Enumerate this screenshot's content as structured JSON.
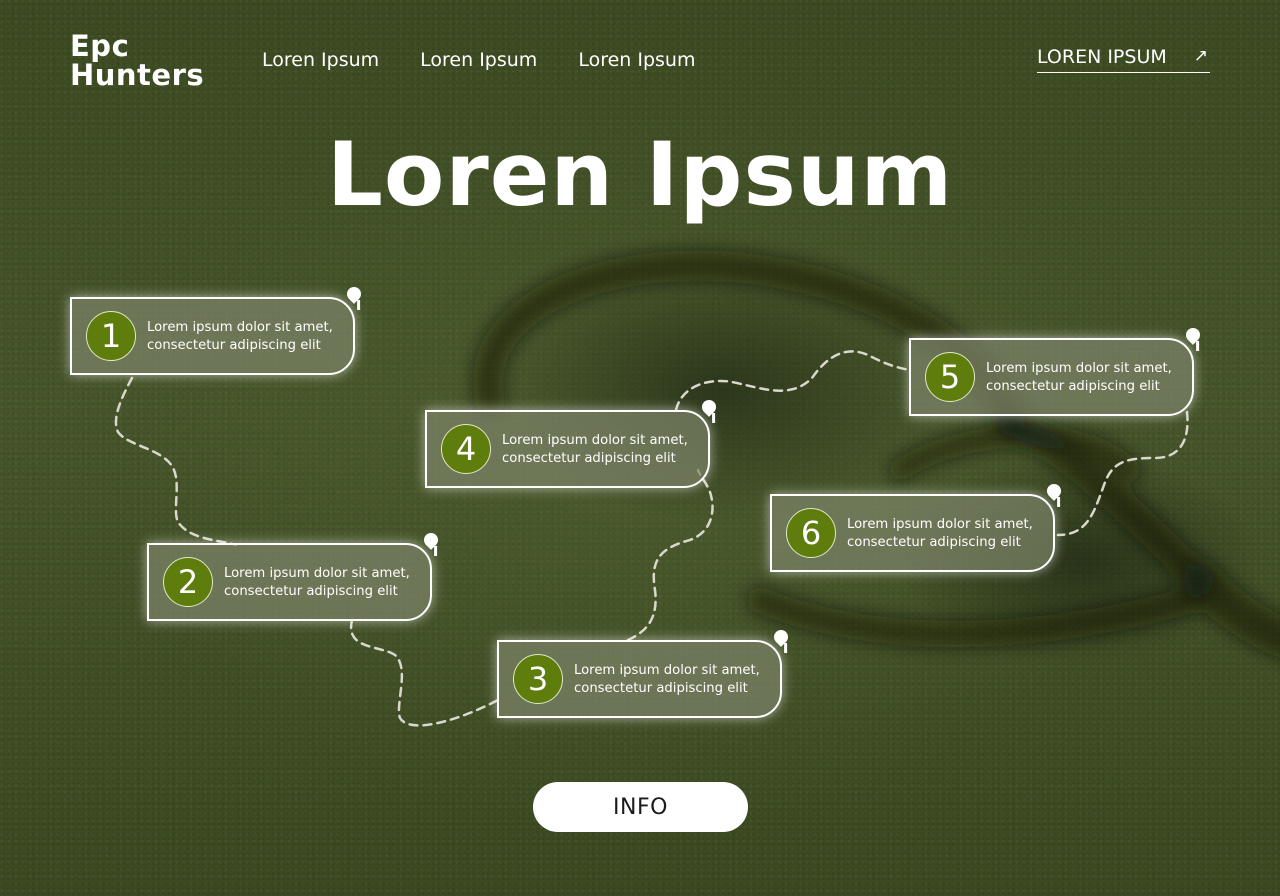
{
  "brand": {
    "line1": "Epc",
    "line2": "Hunters"
  },
  "nav": {
    "items": [
      "Loren Ipsum",
      "Loren Ipsum",
      "Loren Ipsum"
    ]
  },
  "header_cta": {
    "label": "LOREN IPSUM",
    "icon": "arrow-up-right-icon"
  },
  "hero": {
    "title": "Loren Ipsum"
  },
  "steps": [
    {
      "number": "1",
      "line1": "Lorem ipsum dolor sit amet,",
      "line2": "consectetur adipiscing elit"
    },
    {
      "number": "2",
      "line1": "Lorem ipsum dolor sit amet,",
      "line2": "consectetur adipiscing elit"
    },
    {
      "number": "3",
      "line1": "Lorem ipsum dolor sit amet,",
      "line2": "consectetur adipiscing elit"
    },
    {
      "number": "4",
      "line1": "Lorem ipsum dolor sit amet,",
      "line2": "consectetur adipiscing elit"
    },
    {
      "number": "5",
      "line1": "Lorem ipsum dolor sit amet,",
      "line2": "consectetur adipiscing elit"
    },
    {
      "number": "6",
      "line1": "Lorem ipsum dolor sit amet,",
      "line2": "consectetur adipiscing elit"
    }
  ],
  "info_button": {
    "label": "INFO"
  },
  "colors": {
    "background": "#3f4d25",
    "step_circle": "#5f7d0c",
    "card_fill": "#7d8468",
    "text": "#ffffff",
    "button_text": "#1b1b1b"
  }
}
